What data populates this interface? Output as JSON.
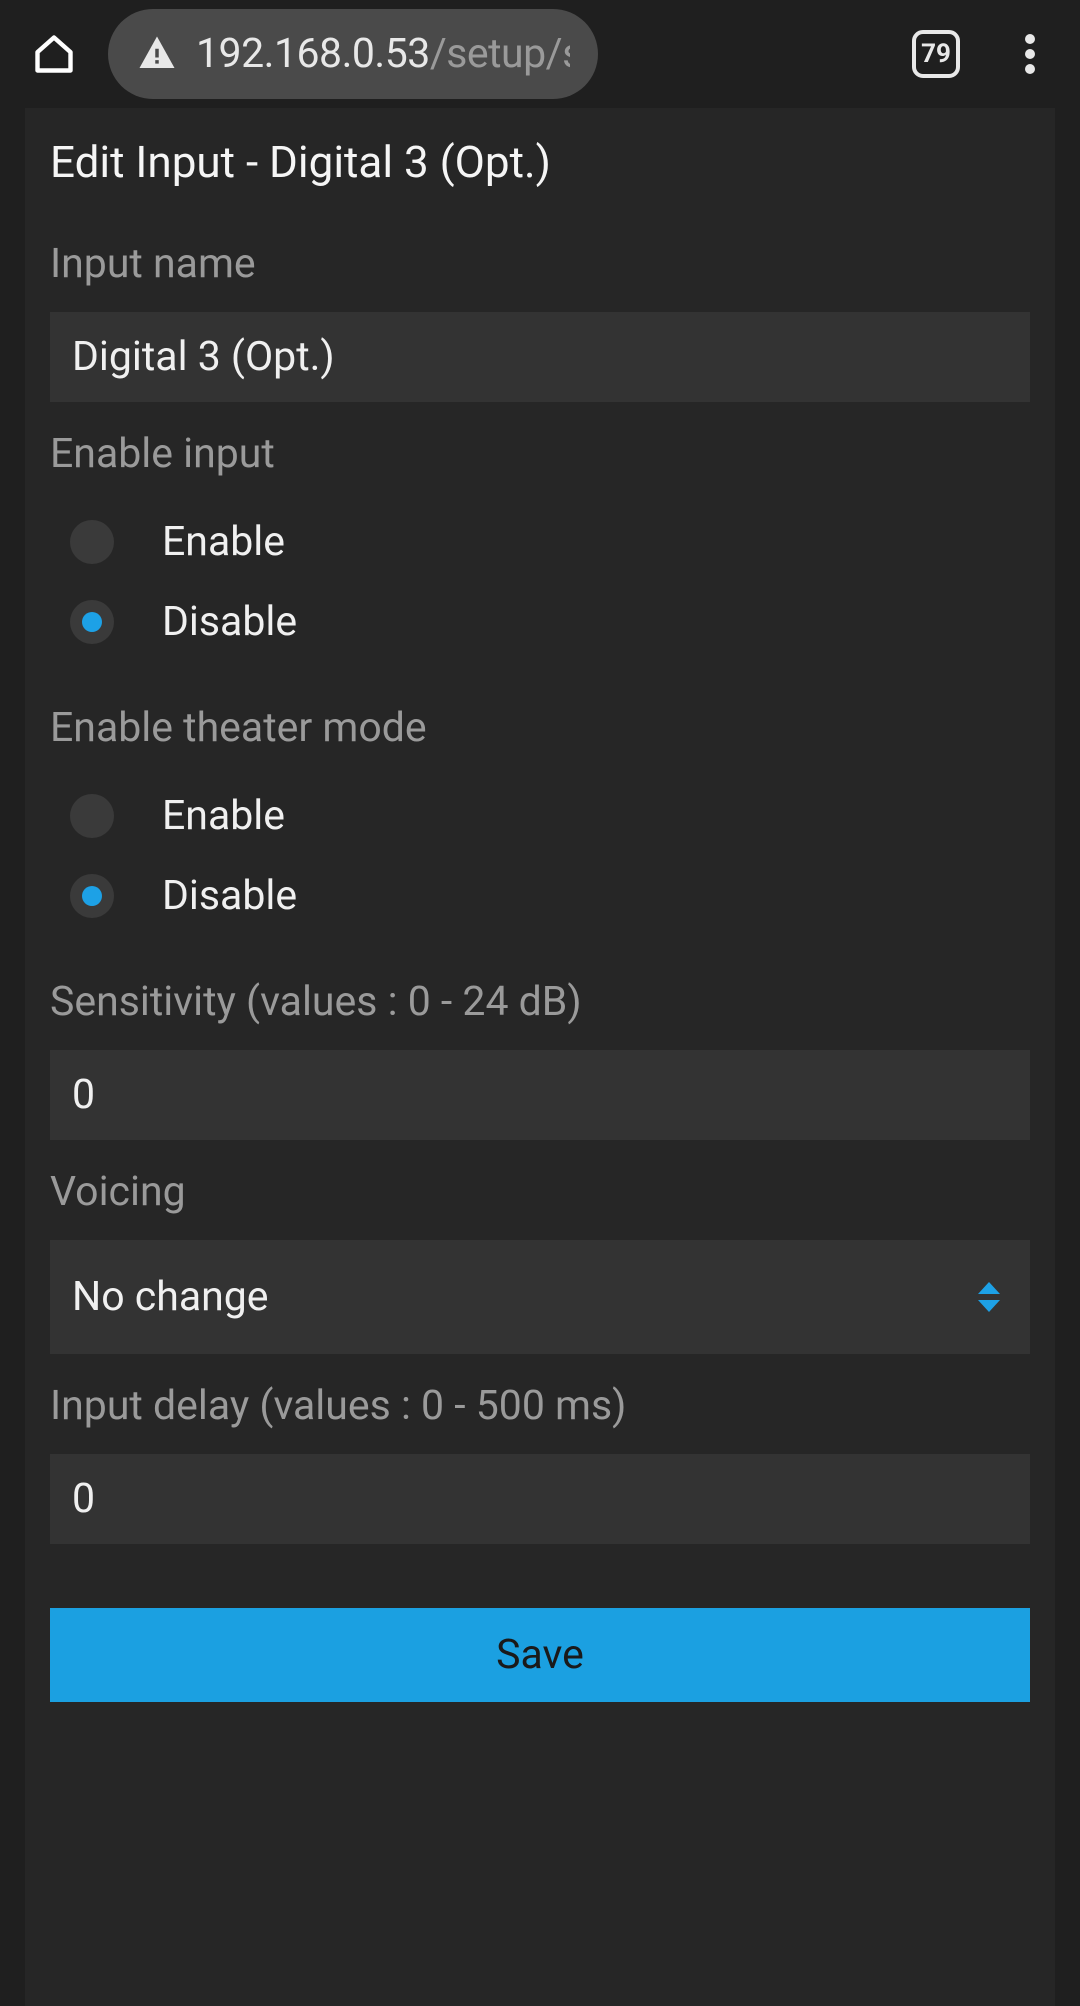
{
  "browser": {
    "url_host": "192.168.0.53",
    "url_path": "/setup/sou",
    "tab_count": "79"
  },
  "page": {
    "title": "Edit Input - Digital 3 (Opt.)"
  },
  "fields": {
    "input_name": {
      "label": "Input name",
      "value": "Digital 3 (Opt.)"
    },
    "enable_input": {
      "label": "Enable input",
      "options": {
        "enable": "Enable",
        "disable": "Disable"
      },
      "selected": "disable"
    },
    "theater_mode": {
      "label": "Enable theater mode",
      "options": {
        "enable": "Enable",
        "disable": "Disable"
      },
      "selected": "disable"
    },
    "sensitivity": {
      "label": "Sensitivity (values : 0 - 24 dB)",
      "value": "0"
    },
    "voicing": {
      "label": "Voicing",
      "value": "No change"
    },
    "input_delay": {
      "label": "Input delay (values : 0 - 500 ms)",
      "value": "0"
    }
  },
  "actions": {
    "save": "Save"
  }
}
